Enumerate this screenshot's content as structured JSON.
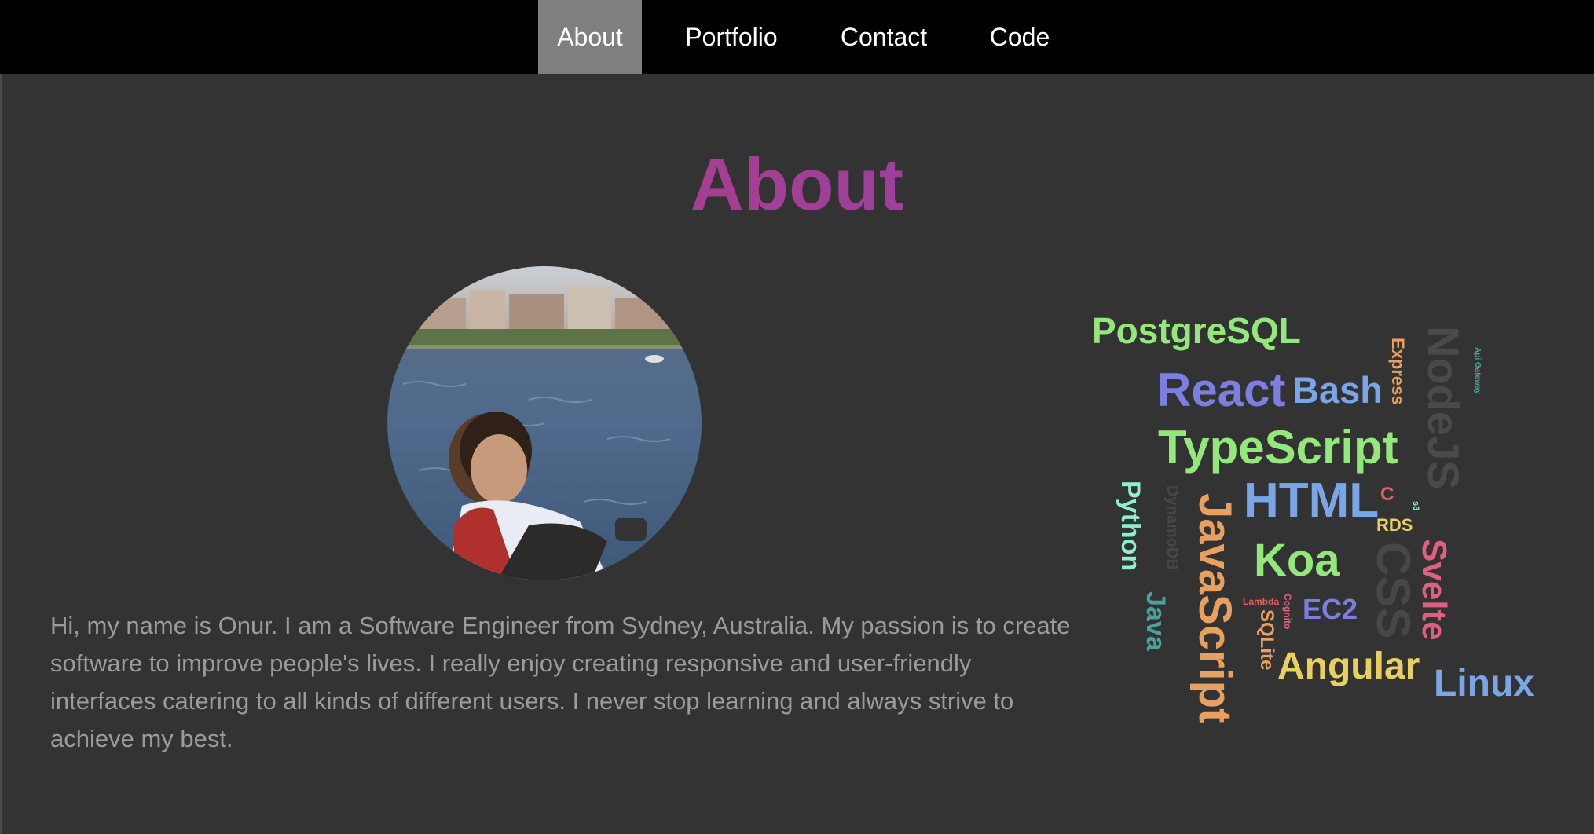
{
  "nav": {
    "items": [
      {
        "label": "About",
        "active": true
      },
      {
        "label": "Portfolio",
        "active": false
      },
      {
        "label": "Contact",
        "active": false
      },
      {
        "label": "Code",
        "active": false
      }
    ]
  },
  "page": {
    "title": "About",
    "bio": "Hi, my name is Onur. I am a Software Engineer from Sydney, Australia. My passion is to create software to improve people's lives. I really enjoy creating responsive and user-friendly interfaces catering to all kinds of different users. I never stop learning and always strive to achieve my best."
  },
  "colors": {
    "nav_bg": "#000000",
    "nav_active": "#7f7f7f",
    "page_bg": "#333333",
    "title_gradient": [
      "#c83d69",
      "#7b4db4"
    ],
    "bio_text": "#9b9b9b"
  },
  "skills": {
    "postgresql": {
      "label": "PostgreSQL",
      "color": "#93e87c"
    },
    "react": {
      "label": "React",
      "color": "#7c7ee0"
    },
    "bash": {
      "label": "Bash",
      "color": "#7aa6e8"
    },
    "express": {
      "label": "Express",
      "color": "#e8a060"
    },
    "nodejs": {
      "label": "NodeJS",
      "color": "#4a4a4a"
    },
    "apigateway": {
      "label": "Api Gateway",
      "color": "#4aa39a"
    },
    "typescript": {
      "label": "TypeScript",
      "color": "#93e87c"
    },
    "html": {
      "label": "HTML",
      "color": "#7aa6e8"
    },
    "c": {
      "label": "C",
      "color": "#e06060"
    },
    "s3": {
      "label": "s3",
      "color": "#8ff0d0"
    },
    "rds": {
      "label": "RDS",
      "color": "#e8d060"
    },
    "python": {
      "label": "Python",
      "color": "#8ff0d0"
    },
    "dynamodb": {
      "label": "DynamoDB",
      "color": "#474747"
    },
    "javascript": {
      "label": "JavaScript",
      "color": "#e8a060"
    },
    "koa": {
      "label": "Koa",
      "color": "#93e87c"
    },
    "css": {
      "label": "CSS",
      "color": "#474747"
    },
    "svelte": {
      "label": "Svelte",
      "color": "#e06080"
    },
    "java": {
      "label": "Java",
      "color": "#4aa39a"
    },
    "lambda": {
      "label": "Lambda",
      "color": "#e06060"
    },
    "cognito": {
      "label": "Cognito",
      "color": "#e06080"
    },
    "sqlite": {
      "label": "SQLite",
      "color": "#e8a060"
    },
    "ec2": {
      "label": "EC2",
      "color": "#7c7ee0"
    },
    "angular": {
      "label": "Angular",
      "color": "#e8d060"
    },
    "linux": {
      "label": "Linux",
      "color": "#7aa6e8"
    }
  }
}
